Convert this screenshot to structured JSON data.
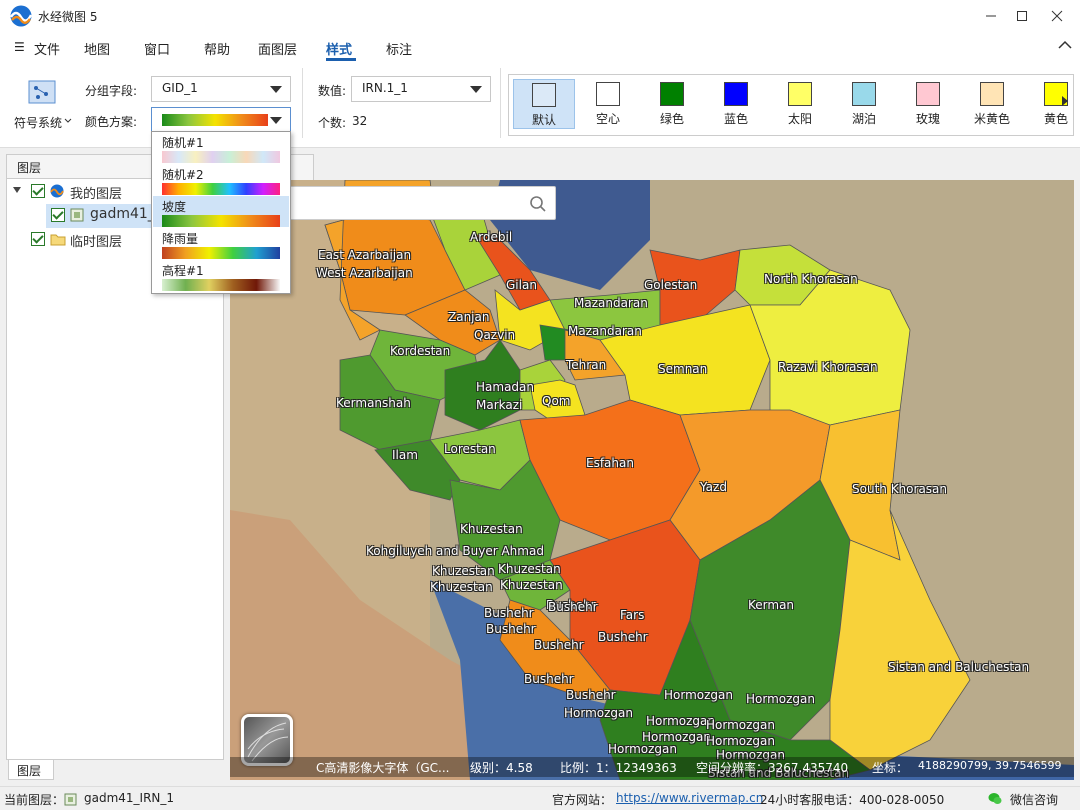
{
  "window": {
    "title": "水经微图 5"
  },
  "menu": {
    "hamburger": "☰",
    "items": [
      "文件",
      "地图",
      "窗口",
      "帮助",
      "面图层",
      "样式",
      "标注"
    ],
    "active_index": 5
  },
  "ribbon": {
    "symbol_system": "符号系统",
    "group_field_label": "分组字段:",
    "group_field_value": "GID_1",
    "color_scheme_label": "颜色方案:",
    "value_label": "数值:",
    "value_value": "IRN.1_1",
    "count_label": "个数:",
    "count_value": "32",
    "swatches": [
      {
        "label": "默认",
        "color": "#dbe9f7",
        "selected": true
      },
      {
        "label": "空心",
        "color": "#ffffff"
      },
      {
        "label": "绿色",
        "color": "#008000"
      },
      {
        "label": "蓝色",
        "color": "#0000ff"
      },
      {
        "label": "太阳",
        "color": "#ffff66"
      },
      {
        "label": "湖泊",
        "color": "#99d9ea"
      },
      {
        "label": "玫瑰",
        "color": "#ffc8d2"
      },
      {
        "label": "米黄色",
        "color": "#ffe4b5"
      },
      {
        "label": "黄色",
        "color": "#ffff00"
      }
    ]
  },
  "color_dropdown": {
    "options": [
      "随机#1",
      "随机#2",
      "坡度",
      "降雨量",
      "高程#1"
    ],
    "highlighted": "坡度"
  },
  "layers": {
    "panel_title": "图层",
    "items": [
      "我的图层",
      "gadm41_",
      "临时图层"
    ],
    "bottom_tab": "图层"
  },
  "map": {
    "search_placeholder": "图",
    "labels": [
      "Ardebil",
      "East Azarbaijan",
      "West Azarbaijan",
      "Gilan",
      "Golestan",
      "North Khorasan",
      "Mazandaran",
      "Mazandaran",
      "Zanjan",
      "Qazvin",
      "Kordestan",
      "Tehran",
      "Semnan",
      "Razavi Khorasan",
      "Hamadan",
      "Markazi",
      "Qom",
      "Kermanshah",
      "Lorestan",
      "Ilam",
      "Esfahan",
      "Yazd",
      "South Khorasan",
      "Khuzestan",
      "Kohgiluyeh and Buyer Ahmad",
      "Khuzestan",
      "Khuzestan",
      "Khuzestan",
      "Khuzestan",
      "Bushehr",
      "Bushehr",
      "Bushehr",
      "Bushehr",
      "Bushehr",
      "Bushehr",
      "Fars",
      "Kerman",
      "Sistan and Baluchestan",
      "Bushehr",
      "Bushehr",
      "Hormozgan",
      "Hormozgan",
      "Hormozgan",
      "Hormozgan",
      "Hormozgan",
      "Hormozgan",
      "Hormozgan",
      "Hormozgan",
      "Hormozgan",
      "Sistan and Baluchestan"
    ],
    "status": {
      "source": "C高清影像大字体（GC...",
      "level": "级别：4.58",
      "scale": "比例：1：12349363",
      "resolution": "空间分辨率：3267.435740",
      "coord": "坐标：",
      "coord_value": "4188290799, 39.7546599"
    }
  },
  "statusbar": {
    "current_layer_label": "当前图层：",
    "current_layer": "gadm41_IRN_1",
    "website_label": "官方网站：",
    "website": "https://www.rivermap.cn",
    "hotline": "24小时客服电话：400-028-0050",
    "wechat": "微信咨询"
  }
}
